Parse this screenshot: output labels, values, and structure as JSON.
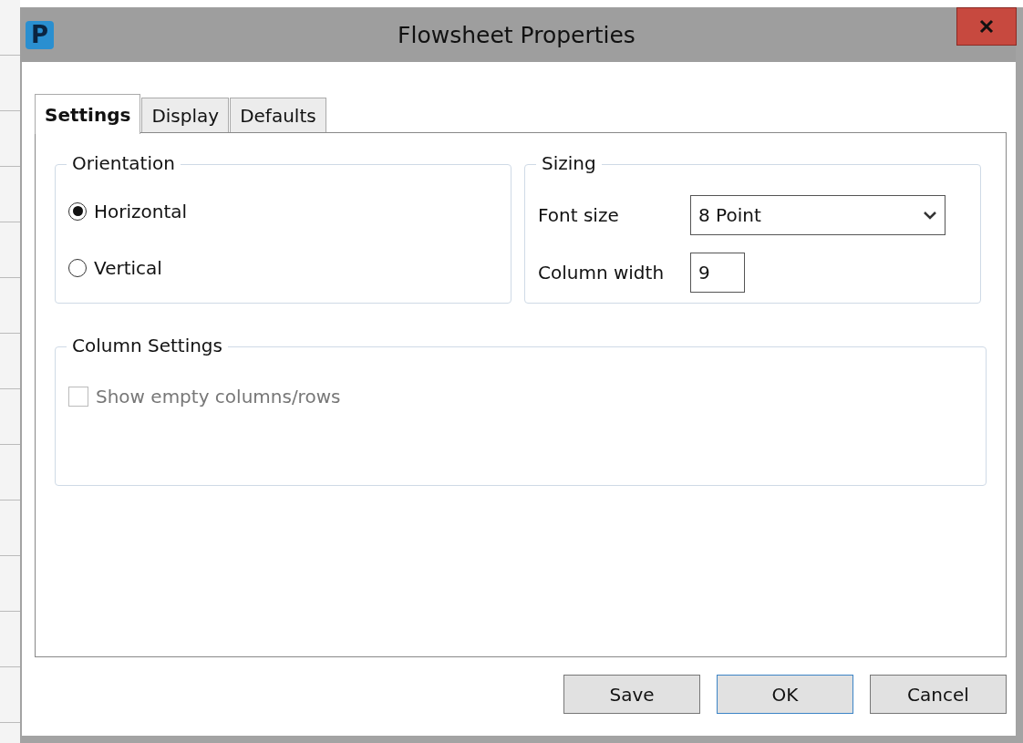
{
  "window": {
    "icon_letter": "P",
    "title": "Flowsheet Properties"
  },
  "tabs": [
    {
      "label": "Settings",
      "selected": true
    },
    {
      "label": "Display",
      "selected": false
    },
    {
      "label": "Defaults",
      "selected": false
    }
  ],
  "orientation": {
    "legend": "Orientation",
    "options": [
      {
        "label": "Horizontal",
        "selected": true
      },
      {
        "label": "Vertical",
        "selected": false
      }
    ]
  },
  "sizing": {
    "legend": "Sizing",
    "font_size": {
      "label": "Font size",
      "value": "8 Point"
    },
    "column_width": {
      "label": "Column width",
      "value": "9"
    }
  },
  "column_settings": {
    "legend": "Column Settings",
    "show_empty": {
      "label": "Show empty columns/rows",
      "checked": false,
      "disabled": true
    }
  },
  "buttons": [
    {
      "label": "Save",
      "default": false
    },
    {
      "label": "OK",
      "default": true
    },
    {
      "label": "Cancel",
      "default": false
    }
  ]
}
